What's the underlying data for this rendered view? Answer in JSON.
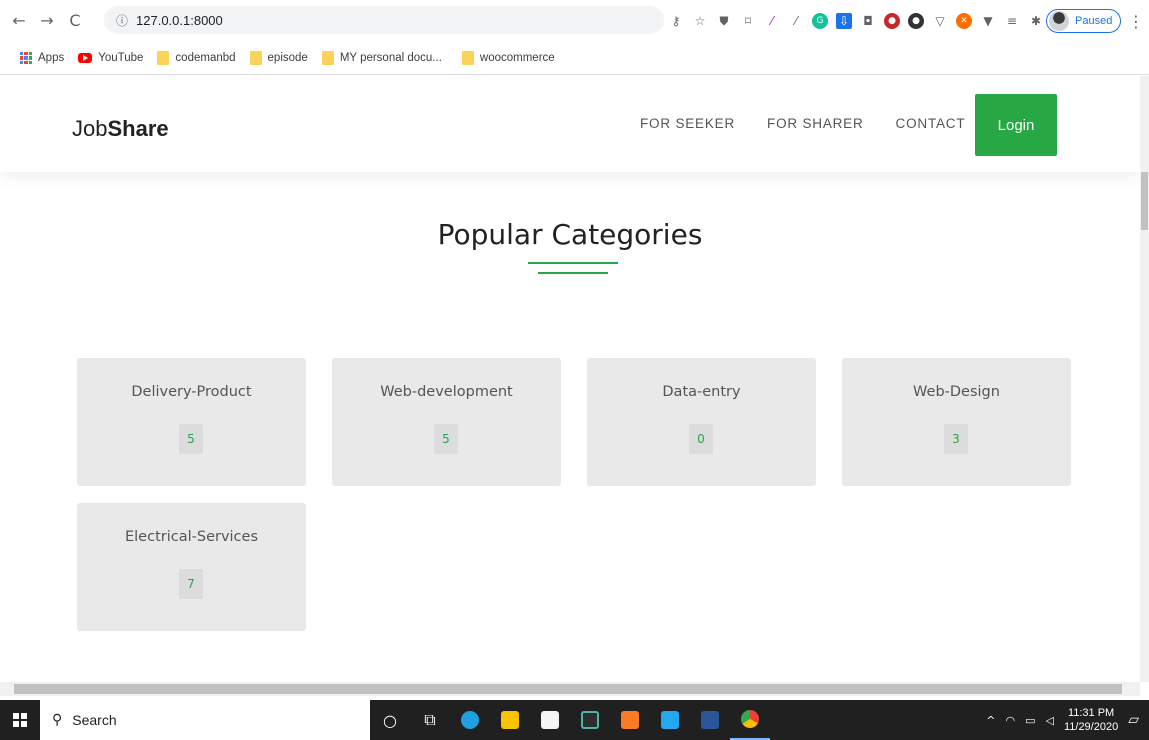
{
  "browser": {
    "url": "127.0.0.1:8000",
    "profile_status": "Paused",
    "bookmarks": [
      {
        "label": "Apps",
        "icon": "apps-grid-icon"
      },
      {
        "label": "YouTube",
        "icon": "youtube-icon"
      },
      {
        "label": "codemanbd",
        "icon": "folder-icon"
      },
      {
        "label": "episode",
        "icon": "folder-icon"
      },
      {
        "label": "MY personal docu...",
        "icon": "folder-icon"
      },
      {
        "label": "woocommerce",
        "icon": "folder-icon"
      }
    ]
  },
  "site": {
    "logo_light": "Job",
    "logo_bold": "Share",
    "nav": [
      "FOR SEEKER",
      "FOR SHARER",
      "CONTACT"
    ],
    "login_label": "Login",
    "accent_color": "#28a745"
  },
  "section": {
    "title": "Popular Categories"
  },
  "categories": [
    {
      "name": "Delivery-Product",
      "count": "5"
    },
    {
      "name": "Web-development",
      "count": "5"
    },
    {
      "name": "Data-entry",
      "count": "0"
    },
    {
      "name": "Web-Design",
      "count": "3"
    },
    {
      "name": "Electrical-Services",
      "count": "7"
    }
  ],
  "taskbar": {
    "search_placeholder": "Search",
    "time": "11:31 PM",
    "date": "11/29/2020"
  }
}
